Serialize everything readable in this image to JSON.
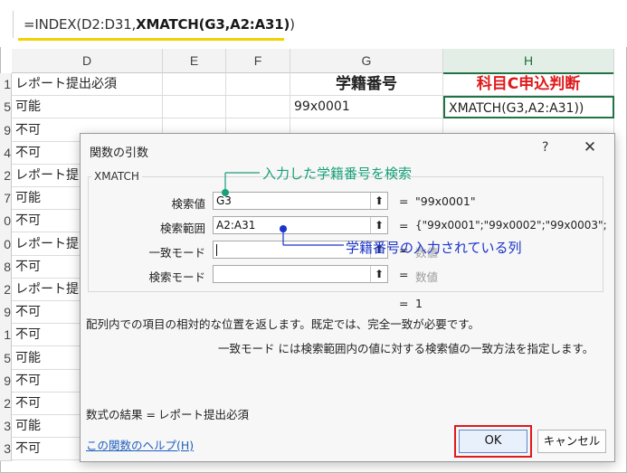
{
  "formula_bar": {
    "prefix": "=INDEX(D2:D31,",
    "bold": "XMATCH(G3,A2:A31)",
    "suffix": ")"
  },
  "columns": [
    {
      "label": "D",
      "selected": false
    },
    {
      "label": "E",
      "selected": false
    },
    {
      "label": "F",
      "selected": false
    },
    {
      "label": "G",
      "selected": false
    },
    {
      "label": "H",
      "selected": true
    }
  ],
  "rows": [
    {
      "num": "1",
      "d": "レポート提出必須"
    },
    {
      "num": "5",
      "d": "可能"
    },
    {
      "num": "9",
      "d": "不可"
    },
    {
      "num": "4",
      "d": "不可"
    },
    {
      "num": "2",
      "d": "レポート提"
    },
    {
      "num": "7",
      "d": "可能"
    },
    {
      "num": "0",
      "d": "不可"
    },
    {
      "num": "0",
      "d": "レポート提"
    },
    {
      "num": "8",
      "d": "不可"
    },
    {
      "num": "2",
      "d": "レポート提"
    },
    {
      "num": "9",
      "d": "不可"
    },
    {
      "num": "1",
      "d": "不可"
    },
    {
      "num": "5",
      "d": "可能"
    },
    {
      "num": "9",
      "d": "不可"
    },
    {
      "num": "2",
      "d": "不可"
    },
    {
      "num": "3",
      "d": "可能"
    },
    {
      "num": "3",
      "d": "不可"
    }
  ],
  "headers": {
    "g": "学籍番号",
    "h": "科目C申込判断"
  },
  "row2": {
    "g": "99x0001",
    "h": "XMATCH(G3,A2:A31))"
  },
  "dialog": {
    "title": "関数の引数",
    "help_icon": "?",
    "close_icon": "✕",
    "function_name": "XMATCH",
    "args": [
      {
        "label": "検索値",
        "value": "G3",
        "eq": "=",
        "result": "\"99x0001\"",
        "gray": false
      },
      {
        "label": "検索範囲",
        "value": "A2:A31",
        "eq": "=",
        "result": "{\"99x0001\";\"99x0002\";\"99x0003\";",
        "gray": false
      },
      {
        "label": "一致モード",
        "value": "",
        "eq": "=",
        "result": "数値",
        "gray": true
      },
      {
        "label": "検索モード",
        "value": "",
        "eq": "=",
        "result": "数値",
        "gray": true
      }
    ],
    "overall_eq": "=",
    "overall_result": "1",
    "description": "配列内での項目の相対的な位置を返します。既定では、完全一致が必要です。",
    "arg_help": "一致モード  には検索範囲内の値に対する検索値の一致方法を指定します。",
    "formula_result_label": "数式の結果 =",
    "formula_result_value": "レポート提出必須",
    "help_link": "この関数のヘルプ(H)",
    "ok_label": "OK",
    "cancel_label": "キャンセル"
  },
  "annotations": {
    "green": "入力した学籍番号を検索",
    "blue": "学籍番号の入力されている列",
    "green_color": "#18a07a",
    "blue_color": "#1b34c9",
    "highlight_color": "#e0191b"
  }
}
